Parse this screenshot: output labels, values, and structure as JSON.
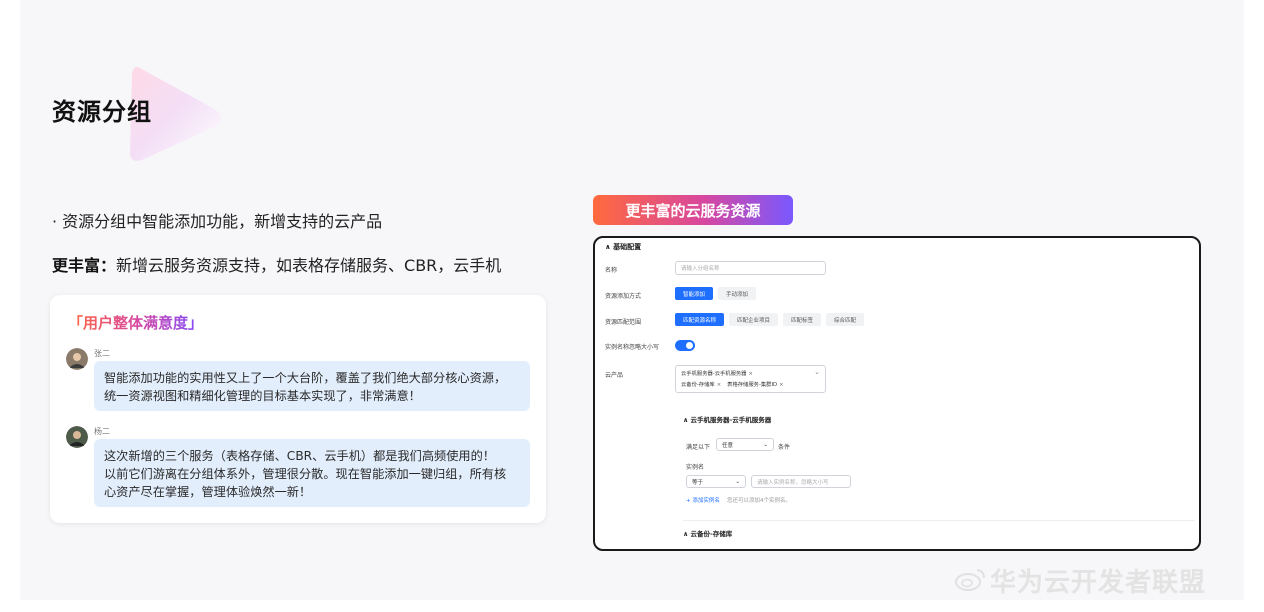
{
  "slide": {
    "title": "资源分组",
    "bullet": "· 资源分组中智能添加功能，新增支持的云产品",
    "rich_label": "更丰富：",
    "rich_text": "新增云服务资源支持，如表格存储服务、CBR，云手机"
  },
  "feedback_card": {
    "title": "「用户整体满意度」",
    "comments": [
      {
        "user": "张二",
        "lines": [
          "智能添加功能的实用性又上了一个大台阶，覆盖了我们绝大部分核心资源，",
          "统一资源视图和精细化管理的目标基本实现了，非常满意！"
        ]
      },
      {
        "user": "杨二",
        "lines": [
          "这次新增的三个服务（表格存储、CBR、云手机）都是我们高频使用的！",
          "以前它们游离在分组体系外，管理很分散。现在智能添加一键归组，所有核",
          "心资产尽在掌握，管理体验焕然一新！"
        ]
      }
    ]
  },
  "banner": {
    "text": "更丰富的云服务资源"
  },
  "screenshot": {
    "section_basic": "基础配置",
    "name_label": "名称",
    "name_placeholder": "请输入分组名称",
    "add_mode_label": "资源添加方式",
    "add_mode_options": [
      "智能添加",
      "手动添加"
    ],
    "scope_label": "资源匹配范围",
    "scope_options": [
      "匹配资源名称",
      "匹配企业项目",
      "匹配标签",
      "综合匹配"
    ],
    "case_label": "实例名称忽略大小写",
    "case_enabled": true,
    "product_label": "云产品",
    "product_tags_row1": [
      "云手机服务器-云手机服务器"
    ],
    "product_tags_row2": [
      "云备份-存储库",
      "表格存储服务-集群ID"
    ],
    "sub_section_1": "云手机服务器-云手机服务器",
    "match_prefix": "满足以下",
    "match_select": "任意",
    "match_suffix": "条件",
    "instance_name_label": "实例名",
    "instance_op": "等于",
    "instance_placeholder": "请输入实例名称，忽略大小写",
    "add_link": "+ 添加实例名",
    "add_hint": "您还可以添加4个实例名。",
    "sub_section_2": "云备份-存储库",
    "collapse_glyph": "∧",
    "dropdown_glyph": "⌄",
    "tag_close_glyph": "×"
  },
  "watermark": {
    "text": "华为云开发者联盟"
  },
  "colors": {
    "accent_blue": "#1e6fff",
    "bubble_bg": "#e3eefc",
    "gradient": [
      "#ff6a3d",
      "#d8489e",
      "#7a58ff"
    ]
  }
}
